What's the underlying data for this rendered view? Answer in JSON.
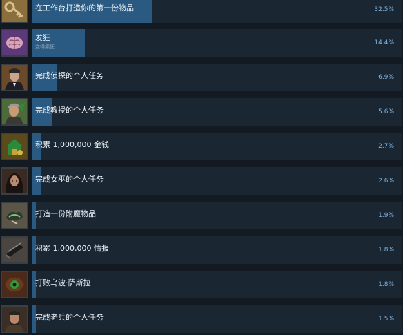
{
  "achievements": [
    {
      "name": "在工作台打造你的第一份物品",
      "desc": "",
      "percent_label": "32.5%",
      "percent": 32.5,
      "icon": "key-icon",
      "icon_bg": "#8a6e3c"
    },
    {
      "name": "发狂",
      "desc": "变得癫狂",
      "percent_label": "14.4%",
      "percent": 14.4,
      "icon": "brain-icon",
      "icon_bg": "#5c3a7a"
    },
    {
      "name": "完成侦探的个人任务",
      "desc": "",
      "percent_label": "6.9%",
      "percent": 6.9,
      "icon": "detective-portrait-icon",
      "icon_bg": "#6b4a2c"
    },
    {
      "name": "完成教授的个人任务",
      "desc": "",
      "percent_label": "5.6%",
      "percent": 5.6,
      "icon": "professor-portrait-icon",
      "icon_bg": "#4d6a3a"
    },
    {
      "name": "积累 1,000,000 金钱",
      "desc": "",
      "percent_label": "2.7%",
      "percent": 2.7,
      "icon": "house-icon",
      "icon_bg": "#5a4a1e"
    },
    {
      "name": "完成女巫的个人任务",
      "desc": "",
      "percent_label": "2.6%",
      "percent": 2.6,
      "icon": "witch-portrait-icon",
      "icon_bg": "#3a2a22"
    },
    {
      "name": "打造一份附魔物品",
      "desc": "",
      "percent_label": "1.9%",
      "percent": 1.9,
      "icon": "enchanted-item-icon",
      "icon_bg": "#5a5546"
    },
    {
      "name": "积累 1,000,000 情报",
      "desc": "",
      "percent_label": "1.8%",
      "percent": 1.8,
      "icon": "books-icon",
      "icon_bg": "#4a4540"
    },
    {
      "name": "打败乌波·萨斯拉",
      "desc": "",
      "percent_label": "1.8%",
      "percent": 1.8,
      "icon": "eye-monster-icon",
      "icon_bg": "#4a2a1a"
    },
    {
      "name": "完成老兵的个人任务",
      "desc": "",
      "percent_label": "1.5%",
      "percent": 1.5,
      "icon": "veteran-portrait-icon",
      "icon_bg": "#3a2e26"
    }
  ],
  "colors": {
    "bar_fill": "#2a5a82",
    "bar_track": "#1b2633",
    "percent_text": "#7fb3de"
  }
}
